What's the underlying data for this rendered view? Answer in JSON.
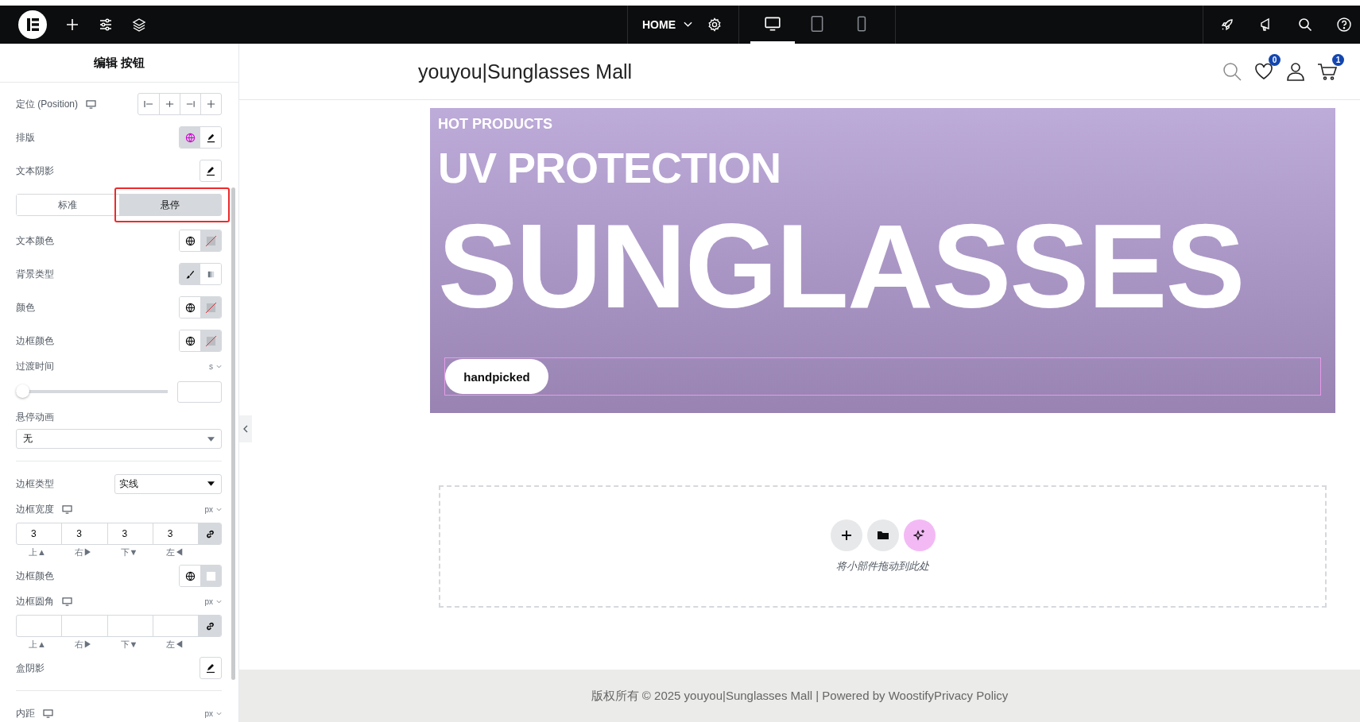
{
  "topbar": {
    "page_menu": "HOME",
    "devices": [
      {
        "kind": "desktop",
        "selected": true
      },
      {
        "kind": "tablet",
        "selected": false
      },
      {
        "kind": "mobile",
        "selected": false
      }
    ]
  },
  "panel": {
    "title": "编辑 按钮",
    "controls": [
      {
        "kind": "align",
        "label": "定位 (Position)",
        "responsive": true
      },
      {
        "kind": "globe-edit",
        "label": "排版",
        "global_active": true
      },
      {
        "kind": "edit",
        "label": "文本阴影"
      },
      {
        "kind": "tabs",
        "highlighted": true,
        "tabs": [
          {
            "label": "标准",
            "selected": false
          },
          {
            "label": "悬停",
            "selected": true
          }
        ]
      },
      {
        "kind": "color",
        "label": "文本颜色",
        "empty": true
      },
      {
        "kind": "bgtype",
        "label": "背景类型",
        "options": [
          {
            "kind": "classic",
            "selected": true
          },
          {
            "kind": "gradient",
            "selected": false
          }
        ]
      },
      {
        "kind": "color",
        "label": "颜色",
        "empty": true
      },
      {
        "kind": "color",
        "label": "边框颜色",
        "empty": true
      },
      {
        "kind": "slider",
        "label": "过渡时间",
        "unit": "s",
        "level": 0
      },
      {
        "kind": "select-stacked",
        "label": "悬停动画",
        "value": "无"
      },
      {
        "kind": "divider"
      },
      {
        "kind": "select",
        "label": "边框类型",
        "value": "实线"
      },
      {
        "kind": "dimensions",
        "label": "边框宽度",
        "responsive": true,
        "unit": "px",
        "values": [
          "3",
          "3",
          "3",
          "3"
        ],
        "sides": [
          "上▲",
          "右▶",
          "下▼",
          "左◀"
        ],
        "linked": true
      },
      {
        "kind": "color",
        "label": "边框颜色",
        "empty": false
      },
      {
        "kind": "dimensions",
        "label": "边框圆角",
        "responsive": true,
        "unit": "px",
        "sides": [
          "上▲",
          "右▶",
          "下▼",
          "左◀"
        ],
        "linked": true
      },
      {
        "kind": "edit",
        "label": "盒阴影"
      },
      {
        "kind": "divider"
      },
      {
        "kind": "unit",
        "label": "内距",
        "responsive": true,
        "unit": "px"
      }
    ]
  },
  "site_header": {
    "logo": "youyou|Sunglasses Mall",
    "wishlist_count": "0",
    "cart_count": "1"
  },
  "hero": {
    "eyebrow": "HOT PRODUCTS",
    "title": "UV PROTECTION",
    "headline": "SUNGLASSES",
    "button": "handpicked"
  },
  "dropzone": {
    "hint": "将小部件拖动到此处"
  },
  "footer": {
    "text": "版权所有 © 2025 youyou|Sunglasses Mall | Powered by WoostifyPrivacy Policy"
  }
}
